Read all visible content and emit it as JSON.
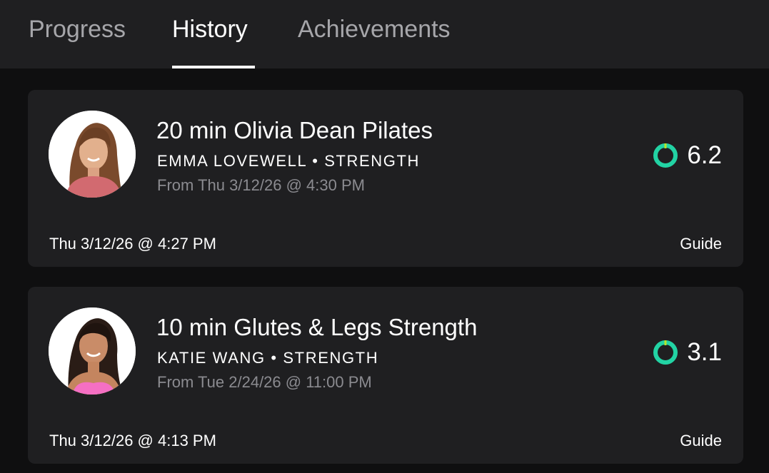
{
  "tabs": [
    {
      "label": "Progress",
      "active": false
    },
    {
      "label": "History",
      "active": true
    },
    {
      "label": "Achievements",
      "active": false
    }
  ],
  "workouts": [
    {
      "title": "20 min Olivia Dean Pilates",
      "meta": "EMMA LOVEWELL • STRENGTH",
      "from": "From Thu 3/12/26 @ 4:30 PM",
      "score": "6.2",
      "date": "Thu 3/12/26 @ 4:27 PM",
      "guide_label": "Guide"
    },
    {
      "title": "10 min Glutes & Legs Strength",
      "meta": "KATIE WANG • STRENGTH",
      "from": "From Tue 2/24/26 @ 11:00 PM",
      "score": "3.1",
      "date": "Thu 3/12/26 @ 4:13 PM",
      "guide_label": "Guide"
    }
  ],
  "colors": {
    "ring": "#22d3a4",
    "ring_marker": "#b7e32a",
    "card_bg": "#1f1f21",
    "page_bg": "#0f0f10"
  },
  "icons": {
    "score_ring": "ring-icon",
    "avatar": "instructor-photo"
  }
}
